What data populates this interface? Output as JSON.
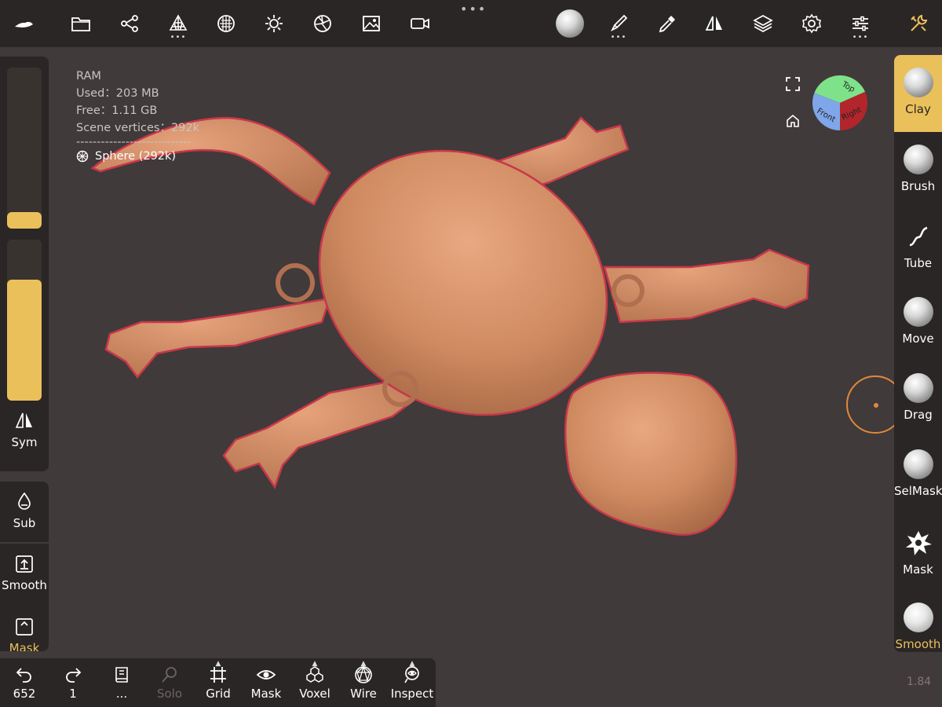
{
  "toolbar": {
    "items": [
      "nomad-logo-icon",
      "folder-icon",
      "scene-graph-icon",
      "topology-icon",
      "material-icon",
      "light-icon",
      "camera-icon",
      "background-icon",
      "video-icon"
    ],
    "right_items": [
      "matcap-sphere-icon",
      "paint-brush-icon",
      "pipette-icon",
      "symmetry-icon",
      "layers-icon",
      "settings-icon",
      "sliders-icon",
      "tools-icon"
    ]
  },
  "stats": {
    "ram_label": "RAM",
    "used": "Used：203 MB",
    "free": "Free：1.11 GB",
    "vertices": "Scene vertices：292k",
    "separator": "----------------------------",
    "object": "Sphere (292k)"
  },
  "left_panel": {
    "radius_level": 0.1,
    "intensity_level": 0.75,
    "sym_label": "Sym",
    "sub_label": "Sub",
    "smooth_label": "Smooth",
    "mask_label": "Mask"
  },
  "right_panel": {
    "tools": [
      {
        "label": "Clay",
        "icon": "clay-ball-icon",
        "active": true
      },
      {
        "label": "Brush",
        "icon": "brush-ball-icon",
        "active": false
      },
      {
        "label": "Tube",
        "icon": "tube-icon",
        "active": false
      },
      {
        "label": "Move",
        "icon": "move-ball-icon",
        "active": false
      },
      {
        "label": "Drag",
        "icon": "drag-ball-icon",
        "active": false
      },
      {
        "label": "SelMask",
        "icon": "selmask-ball-icon",
        "active": false
      },
      {
        "label": "Mask",
        "icon": "mask-splat-icon",
        "active": false
      },
      {
        "label": "Smooth",
        "icon": "smooth-ball-icon",
        "active": false
      }
    ]
  },
  "bottom_bar": {
    "undo_count": "652",
    "redo_count": "1",
    "history_label": "...",
    "solo_label": "Solo",
    "grid_label": "Grid",
    "mask_label": "Mask",
    "voxel_label": "Voxel",
    "wire_label": "Wire",
    "inspect_label": "Inspect"
  },
  "view_cube": {
    "top": "Top",
    "front": "Front",
    "right": "Right"
  },
  "version": "1.84",
  "colors": {
    "accent": "#eac05b",
    "panel": "#2a2625",
    "viewport": "#403a3a",
    "model": "#d08a62",
    "selection_outline": "#c8374a",
    "cursor": "#e0893a"
  }
}
